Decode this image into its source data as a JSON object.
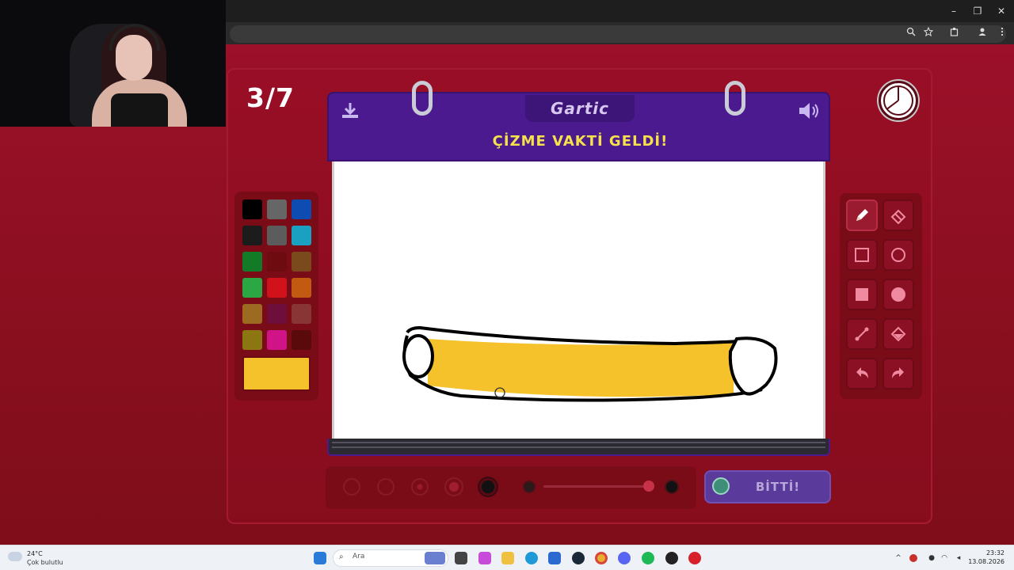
{
  "browser": {
    "window_controls": [
      "–",
      "❐",
      "✕"
    ],
    "toolbar_icons": [
      "zoom-icon",
      "star-icon",
      "extensions-icon",
      "profile-icon",
      "menu-icon"
    ]
  },
  "game": {
    "round_counter": "3/7",
    "logo": "Gartic",
    "header_title": "ÇİZME VAKTİ GELDİ!",
    "done_button": "BİTTİ!",
    "selected_color": "#f5c22b",
    "palette_colors": [
      "#000000",
      "#666666",
      "#0f4cb2",
      "#1c1c1c",
      "#5c5c5c",
      "#1aa1c2",
      "#137a27",
      "#6e0b10",
      "#7a4a1d",
      "#2ba844",
      "#d1121a",
      "#c25a12",
      "#9c6a20",
      "#6e0e3a",
      "#8a3535",
      "#8c7612",
      "#d01487",
      "#5a0a0a"
    ],
    "tools": [
      {
        "name": "pencil-icon",
        "active": true
      },
      {
        "name": "eraser-icon",
        "active": false
      },
      {
        "name": "rectangle-outline-icon",
        "active": false
      },
      {
        "name": "circle-outline-icon",
        "active": false
      },
      {
        "name": "rectangle-fill-icon",
        "active": false
      },
      {
        "name": "circle-fill-icon",
        "active": false
      },
      {
        "name": "line-icon",
        "active": false
      },
      {
        "name": "fill-bucket-icon",
        "active": false
      },
      {
        "name": "undo-icon",
        "active": false
      },
      {
        "name": "redo-icon",
        "active": false
      }
    ],
    "colors": {
      "background": "#8e0f1e",
      "header": "#4b1a8e",
      "title": "#f5e14c",
      "done_button": "#5a3a9a"
    }
  },
  "taskbar": {
    "weather_temp": "24°C",
    "weather_desc": "Çok bulutlu",
    "search_placeholder": "Ara",
    "time": "23:32",
    "date": "13.08.2026",
    "apps": [
      "windows-start-icon",
      "search-icon",
      "widgets-icon",
      "task-view-icon",
      "copilot-icon",
      "file-explorer-icon",
      "edge-icon",
      "store-icon",
      "steam-icon",
      "chrome-icon",
      "discord-icon",
      "spotify-icon",
      "github-icon",
      "app-icon"
    ]
  }
}
